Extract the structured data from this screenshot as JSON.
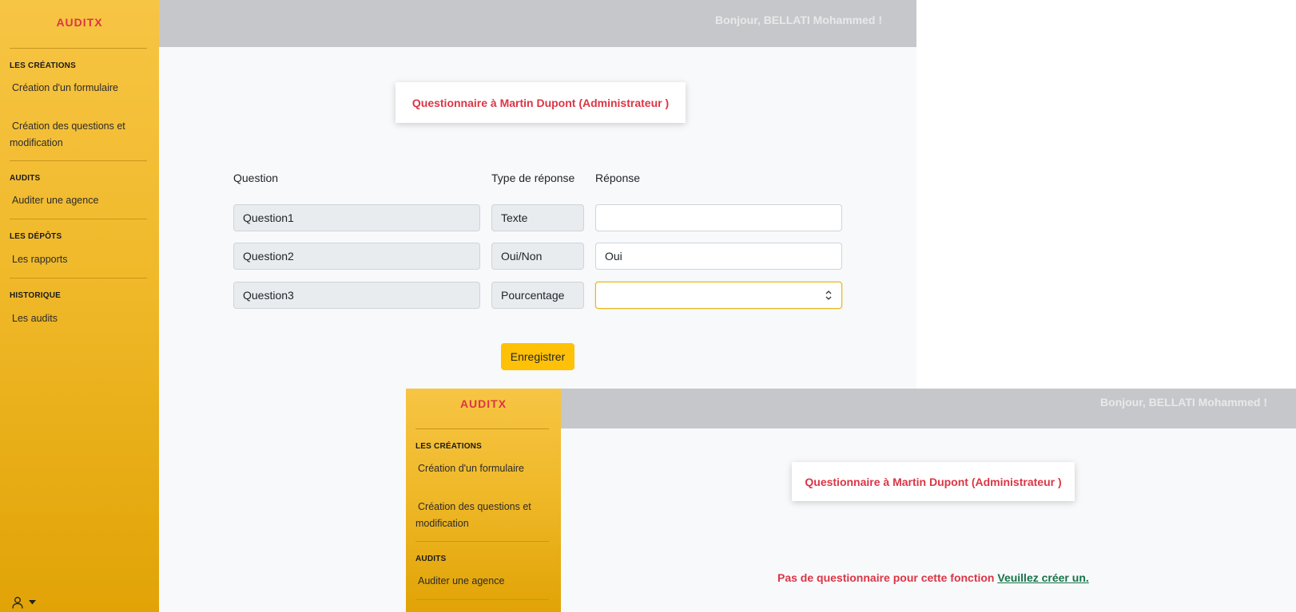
{
  "app": {
    "brand": "AUDITX",
    "greeting": "Bonjour, BELLATI Mohammed !",
    "sidebar": {
      "sections": [
        {
          "title": "LES CRÉATIONS",
          "items": [
            "Création d'un formulaire",
            "Création des questions et",
            "modification"
          ]
        },
        {
          "title": "AUDITS",
          "items": [
            "Auditer une agence"
          ]
        },
        {
          "title": "LES DÉPÔTS",
          "items": [
            "Les rapports"
          ]
        },
        {
          "title": "HISTORIQUE",
          "items": [
            "Les audits"
          ]
        }
      ]
    }
  },
  "form": {
    "title": "Questionnaire à Martin Dupont (Administrateur )",
    "headers": {
      "question": "Question",
      "type": "Type de réponse",
      "answer": "Réponse"
    },
    "rows": [
      {
        "question": "Question1",
        "type": "Texte",
        "answer": ""
      },
      {
        "question": "Question2",
        "type": "Oui/Non",
        "answer": "Oui"
      },
      {
        "question": "Question3",
        "type": "Pourcentage",
        "answer": ""
      }
    ],
    "save_label": "Enregistrer"
  },
  "empty": {
    "title": "Questionnaire à Martin Dupont (Administrateur )",
    "message": "Pas de questionnaire pour cette fonction",
    "link": "Veuillez créer un."
  },
  "colors": {
    "sidebar": "#f0b92a",
    "accent_red": "#dc3545",
    "button": "#ffc107",
    "link_green": "#157347",
    "topbar": "#c6c7ca"
  },
  "icons": {
    "user": "user-icon",
    "caret": "caret-down-icon",
    "spinner": "number-spinner-icon"
  }
}
